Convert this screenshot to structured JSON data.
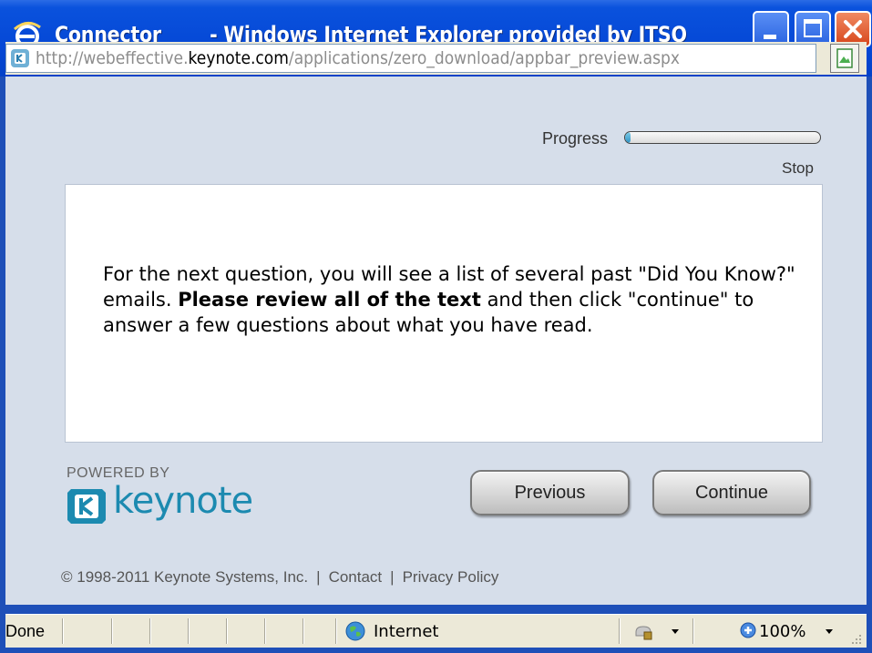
{
  "window": {
    "title_page": "Connector",
    "title_app": "- Windows Internet Explorer provided by ITSO",
    "icon": "ie-logo-icon",
    "controls": [
      "minimize-icon",
      "maximize-icon",
      "close-icon"
    ]
  },
  "address": {
    "url_prefix": "http://webeffective.",
    "url_host": "keynote.com",
    "url_suffix": "/applications/zero_download/appbar_preview.aspx",
    "site_icon": "keynote-favicon-icon",
    "page_icon": "page-picture-icon"
  },
  "progress": {
    "label": "Progress",
    "value_percent": 3,
    "stop_label": "Stop"
  },
  "message": {
    "part1": "For the next question, you will see a list of several past \"Did You Know?\" emails. ",
    "bold": "Please review all of the text",
    "part2": " and then click \"continue\" to answer a few questions about what you have read."
  },
  "branding": {
    "powered_by": "POWERED BY",
    "logo_text": "keynote",
    "logo_icon": "keynote-logo-icon"
  },
  "buttons": {
    "previous": "Previous",
    "continue": "Continue"
  },
  "footer": {
    "copyright": "© 1998-2011 Keynote Systems, Inc.",
    "separator": "|",
    "contact": "Contact",
    "privacy": "Privacy Policy"
  },
  "status": {
    "text": "Done",
    "zone": "Internet",
    "zoom": "100%"
  },
  "colors": {
    "title_bar": "#0548d6",
    "content_bg": "#d6deea",
    "keynote_brand": "#1c8ab0",
    "progress_fill": "#2f93c5"
  }
}
